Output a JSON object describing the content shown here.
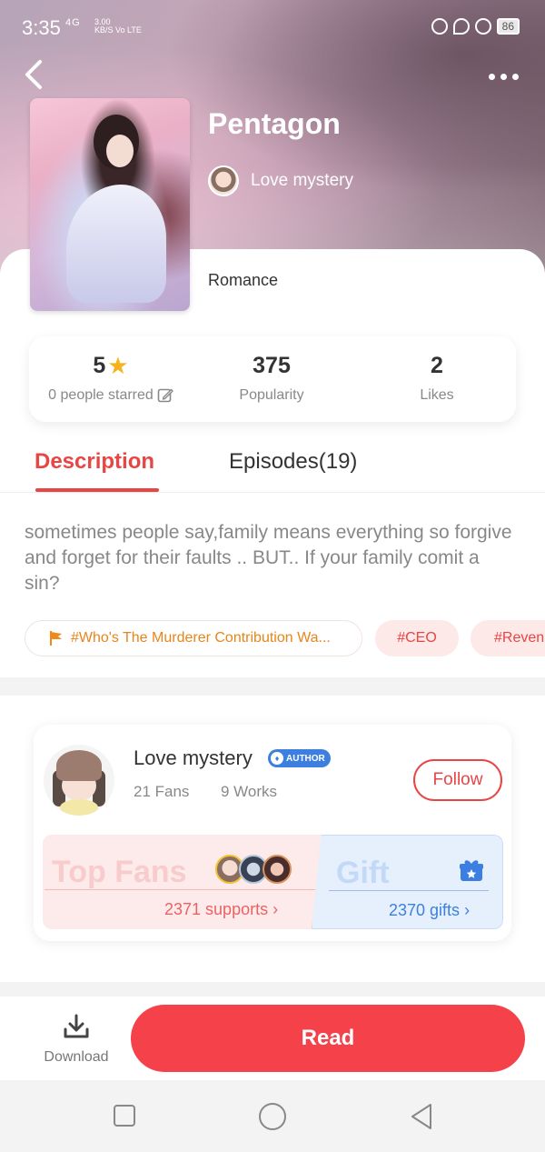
{
  "status_bar": {
    "time": "3:35",
    "network": "4G",
    "speed_value": "3.00",
    "speed_unit": "KB/S",
    "carrier": "Vo LTE",
    "battery": "86"
  },
  "book": {
    "title": "Pentagon",
    "author": "Love mystery",
    "genre": "Romance"
  },
  "stats": {
    "rating": "5",
    "rating_label": "0 people starred",
    "popularity": "375",
    "popularity_label": "Popularity",
    "likes": "2",
    "likes_label": "Likes"
  },
  "tabs": {
    "description": "Description",
    "episodes": "Episodes(19)"
  },
  "description": "sometimes people say,family means everything so forgive and forget for their faults .. BUT.. If your family comit a sin?",
  "tags": {
    "contribution": "#Who's The Murderer Contribution Wa...",
    "ceo": "#CEO",
    "revenge": "#Reven"
  },
  "author_card": {
    "name": "Love mystery",
    "badge": "AUTHOR",
    "fans": "21 Fans",
    "works": "9 Works",
    "follow_label": "Follow",
    "top_fans_title": "Top Fans",
    "supports": "2371 supports",
    "gift_title": "Gift",
    "gifts": "2370 gifts"
  },
  "action_bar": {
    "download_label": "Download",
    "read_label": "Read"
  },
  "colors": {
    "accent": "#e84545",
    "read_button": "#f5414a",
    "tag_orange": "#e7851c",
    "star": "#f5b21b",
    "author_badge": "#3c7fe0"
  }
}
